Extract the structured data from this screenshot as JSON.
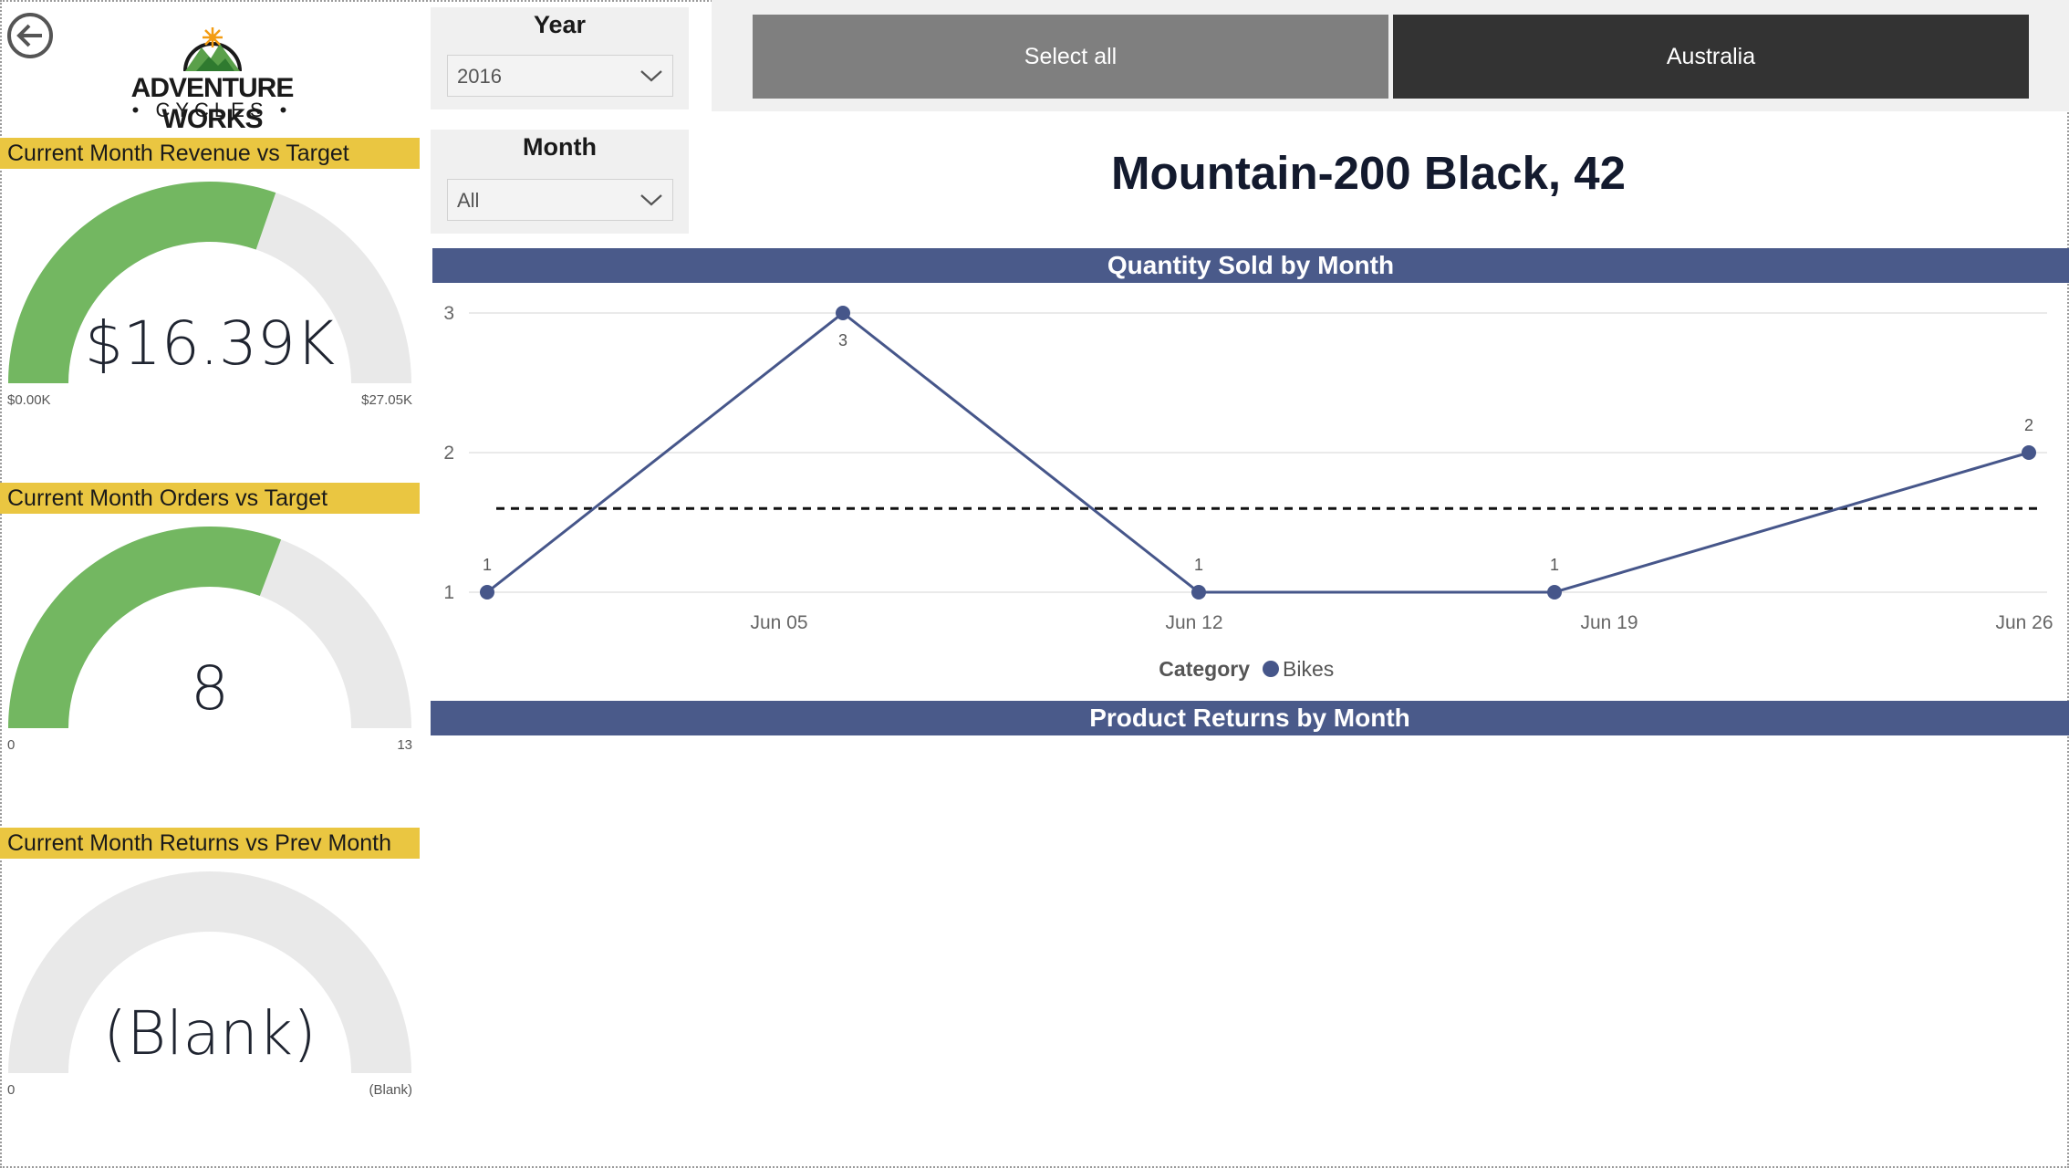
{
  "nav": {
    "back_icon": "back-arrow-icon"
  },
  "logo": {
    "line1": "ADVENTURE WORKS",
    "line2": "• CYCLES •"
  },
  "kpis": [
    {
      "header": "Current Month Revenue vs Target",
      "value": "$16.39K",
      "min": "$0.00K",
      "max": "$27.05K",
      "fill_fraction": 0.606,
      "fill_color": "#73b761"
    },
    {
      "header": "Current Month Orders vs Target",
      "value": "8",
      "min": "0",
      "max": "13",
      "fill_fraction": 0.615,
      "fill_color": "#73b761"
    },
    {
      "header": "Current Month Returns vs Prev Month",
      "value": "(Blank)",
      "min": "0",
      "max": "(Blank)",
      "fill_fraction": 0,
      "fill_color": "#73b761"
    }
  ],
  "slicers": {
    "year": {
      "title": "Year",
      "selected": "2016"
    },
    "month": {
      "title": "Month",
      "selected": "All"
    }
  },
  "tiles": {
    "select_all": "Select all",
    "country": "Australia"
  },
  "product_title": "Mountain-200 Black, 42",
  "colors": {
    "header_yellow": "#eac641",
    "section_blue": "#4a5a8a",
    "series_blue": "#46568a",
    "gauge_grey": "#e9e9e9",
    "tile_grey": "#7f7f7f",
    "tile_dark": "#333333"
  },
  "sections": {
    "quantity_title": "Quantity Sold by Month",
    "returns_title": "Product Returns by Month"
  },
  "chart_data": {
    "type": "line",
    "title": "Quantity Sold by Month",
    "x": [
      "2016-06-01",
      "2016-06-07",
      "2016-06-13",
      "2016-06-19",
      "2016-06-27"
    ],
    "x_ticks": [
      "Jun 05",
      "Jun 12",
      "Jun 19",
      "Jun 26"
    ],
    "y_ticks": [
      1,
      2,
      3
    ],
    "ylim": [
      1,
      3
    ],
    "series": [
      {
        "name": "Bikes",
        "values": [
          1,
          3,
          1,
          1,
          2
        ],
        "labels": [
          "1",
          "3",
          "1",
          "1",
          "2"
        ]
      }
    ],
    "reference_line": 1.6,
    "legend": {
      "title": "Category",
      "placement": "bottom-center"
    },
    "grid": true
  }
}
